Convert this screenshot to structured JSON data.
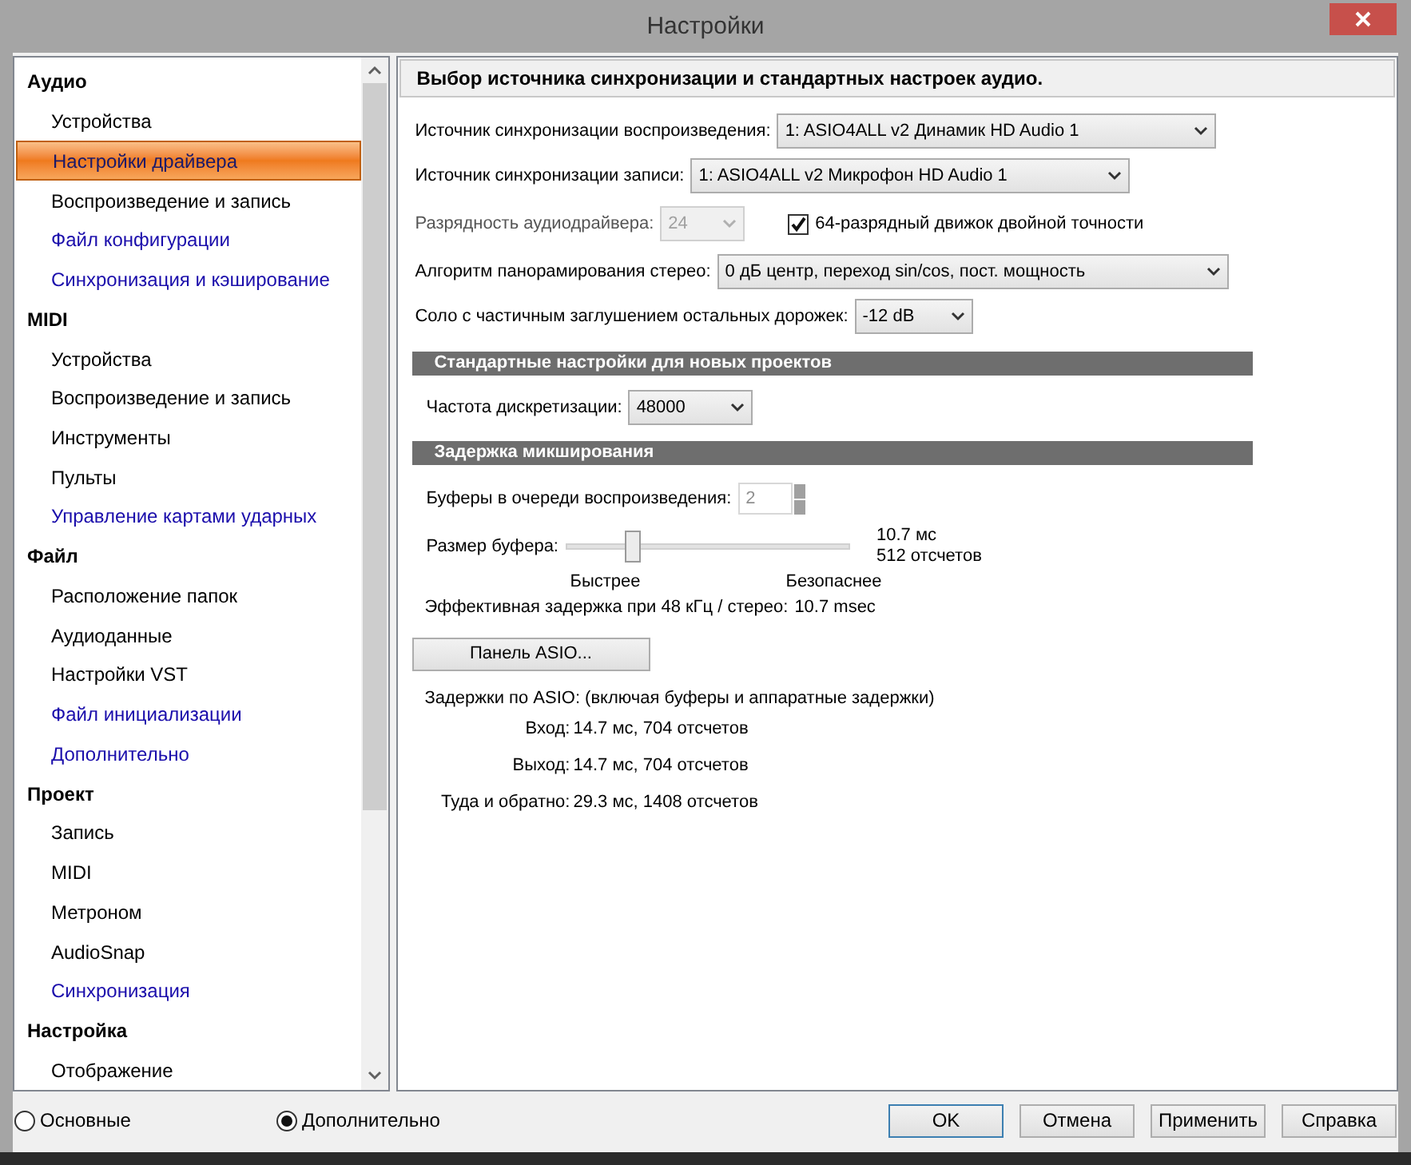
{
  "window": {
    "title": "Настройки"
  },
  "sidebar": {
    "items": [
      {
        "label": "Аудио",
        "kind": "category",
        "selected": false
      },
      {
        "label": "Устройства",
        "kind": "page",
        "selected": false
      },
      {
        "label": "Настройки драйвера",
        "kind": "page",
        "selected": true
      },
      {
        "label": "Воспроизведение и запись",
        "kind": "page",
        "selected": false
      },
      {
        "label": "Файл конфигурации",
        "kind": "advanced",
        "selected": false
      },
      {
        "label": "Синхронизация и кэширование",
        "kind": "advanced",
        "selected": false
      },
      {
        "label": "MIDI",
        "kind": "category",
        "selected": false
      },
      {
        "label": "Устройства",
        "kind": "page",
        "selected": false
      },
      {
        "label": "Воспроизведение и запись",
        "kind": "page",
        "selected": false
      },
      {
        "label": "Инструменты",
        "kind": "page",
        "selected": false
      },
      {
        "label": "Пульты",
        "kind": "page",
        "selected": false
      },
      {
        "label": "Управление картами ударных",
        "kind": "advanced",
        "selected": false
      },
      {
        "label": "Файл",
        "kind": "category",
        "selected": false
      },
      {
        "label": "Расположение папок",
        "kind": "page",
        "selected": false
      },
      {
        "label": "Аудиоданные",
        "kind": "page",
        "selected": false
      },
      {
        "label": "Настройки VST",
        "kind": "page",
        "selected": false
      },
      {
        "label": "Файл инициализации",
        "kind": "advanced",
        "selected": false
      },
      {
        "label": "Дополнительно",
        "kind": "advanced",
        "selected": false
      },
      {
        "label": "Проект",
        "kind": "category",
        "selected": false
      },
      {
        "label": "Запись",
        "kind": "page",
        "selected": false
      },
      {
        "label": "MIDI",
        "kind": "page",
        "selected": false
      },
      {
        "label": "Метроном",
        "kind": "page",
        "selected": false
      },
      {
        "label": "AudioSnap",
        "kind": "page",
        "selected": false
      },
      {
        "label": "Синхронизация",
        "kind": "advanced",
        "selected": false
      },
      {
        "label": "Настройка",
        "kind": "category",
        "selected": false
      },
      {
        "label": "Отображение",
        "kind": "page",
        "selected": false
      }
    ]
  },
  "panel": {
    "header": "Выбор источника синхронизации и стандартных настроек аудио.",
    "sync_sources": [
      {
        "label": "Источник синхронизации воспроизведения:",
        "value": "1: ASIO4ALL v2 Динамик HD Audio 1"
      },
      {
        "label": "Источник синхронизации записи:",
        "value": "1: ASIO4ALL v2 Микрофон HD Audio 1"
      }
    ],
    "bit_depth": {
      "label": "Разрядность аудиодрайвера:",
      "value": "24",
      "disabled": true
    },
    "engine64": {
      "label": "64-разрядный движок двойной точности",
      "checked": true
    },
    "pan_law": {
      "label": "Алгоритм панорамирования стерео:",
      "value": "0 дБ центр, переход sin/cos, пост. мощность"
    },
    "solo": {
      "label": "Соло с частичным заглушением остальных дорожек:",
      "value": "-12 dB"
    },
    "defaults_section": "Стандартные настройки для новых проектов",
    "sample_rate": {
      "label": "Частота дискретизации:",
      "value": "48000"
    },
    "latency_section": "Задержка микширования",
    "buffers": {
      "label": "Буферы в очереди воспроизведения:",
      "value": "2",
      "disabled": true
    },
    "buffer_size": {
      "label": "Размер буфера:",
      "level": 0.24,
      "reading_ms": "10.7 мс",
      "reading_samples": "512 отсчетов",
      "left_label": "Быстрее",
      "right_label": "Безопаснее"
    },
    "effective": {
      "label": "Эффективная задержка при 48 кГц / стерео:",
      "value": "10.7 msec"
    },
    "asio_button": "Панель ASIO...",
    "asio_latency": {
      "label": "Задержки по ASIO: (включая буферы и аппаратные задержки)",
      "rows": [
        {
          "label": "Вход:",
          "value": "14.7 мс, 704 отсчетов"
        },
        {
          "label": "Выход:",
          "value": "14.7 мс, 704 отсчетов"
        },
        {
          "label": "Туда и обратно:",
          "value": "29.3 мс, 1408 отсчетов"
        }
      ]
    }
  },
  "view_modes": [
    {
      "label": "Основные",
      "selected": false
    },
    {
      "label": "Дополнительно",
      "selected": true
    }
  ],
  "buttons": [
    {
      "label": "OK",
      "default": true
    },
    {
      "label": "Отмена",
      "default": false
    },
    {
      "label": "Применить",
      "default": false
    },
    {
      "label": "Справка",
      "default": false
    }
  ]
}
